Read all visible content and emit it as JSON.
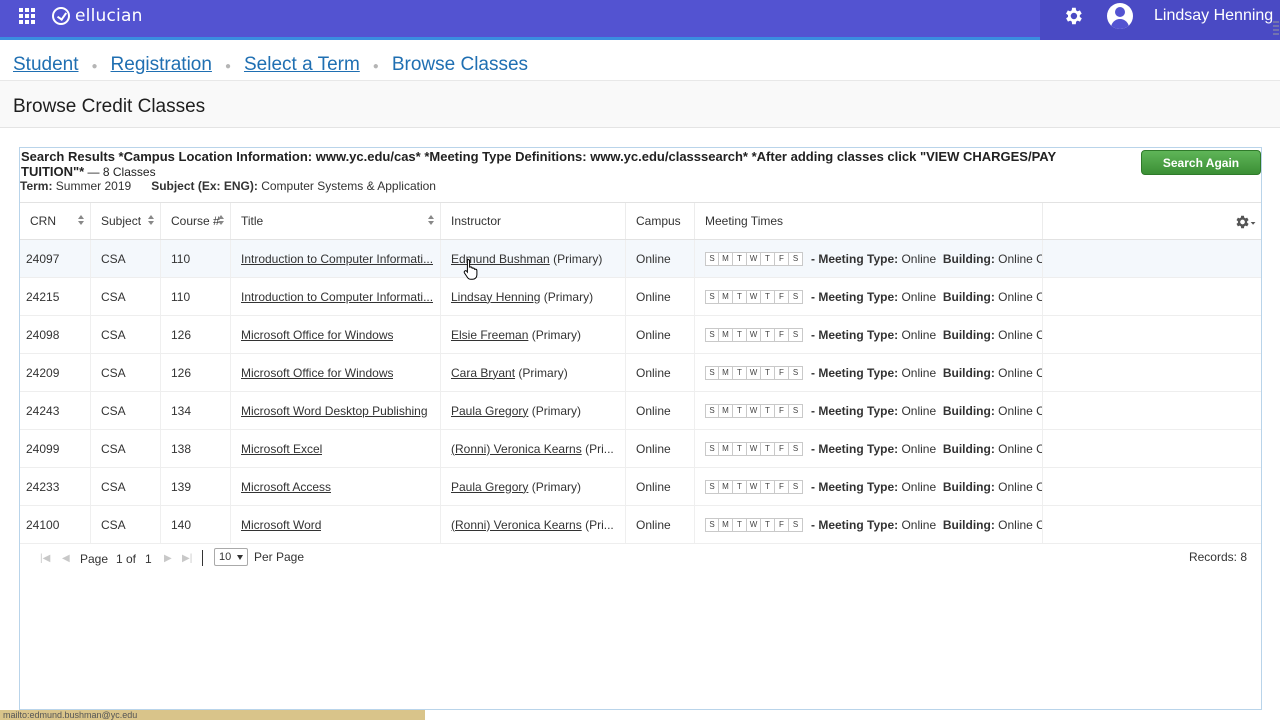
{
  "topbar": {
    "brand": "ellucian",
    "user_name": "Lindsay Henning",
    "icons": [
      "apps-grid-icon",
      "ellucian-logo-icon",
      "gear-icon",
      "user-avatar-icon"
    ],
    "colors": {
      "bar": "#5353d1",
      "accent": "#3a8de0"
    }
  },
  "breadcrumb": {
    "items": [
      "Student",
      "Registration",
      "Select a Term"
    ],
    "current": "Browse Classes",
    "separator": "●"
  },
  "page": {
    "title": "Browse Credit Classes"
  },
  "results": {
    "title": "Search Results *Campus Location Information: www.yc.edu/cas* *Meeting Type Definitions: www.yc.edu/classsearch* *After adding classes click \"VIEW CHARGES/PAY TUITION\"*",
    "count": " — 8 Classes",
    "term_label": "Term:",
    "term_value": "Summer 2019",
    "subject_label": "Subject (Ex: ENG):",
    "subject_value": "Computer Systems & Application",
    "search_again_label": "Search Again"
  },
  "table": {
    "columns": [
      "CRN",
      "Subject",
      "Course #",
      "Title",
      "Instructor",
      "Campus",
      "Meeting Times"
    ],
    "days": [
      "S",
      "M",
      "T",
      "W",
      "T",
      "F",
      "S"
    ],
    "meeting_type_label": "- Meeting Type:",
    "meeting_type_value": "Online",
    "building_label": "Building:",
    "building_value": "Online Cou",
    "rows": [
      {
        "crn": "24097",
        "subject": "CSA",
        "course": "110",
        "title": "Introduction to Computer Informati...",
        "instructor": "Edmund Bushman",
        "role": " (Primary)",
        "campus": "Online"
      },
      {
        "crn": "24215",
        "subject": "CSA",
        "course": "110",
        "title": "Introduction to Computer Informati...",
        "instructor": "Lindsay Henning",
        "role": " (Primary)",
        "campus": "Online"
      },
      {
        "crn": "24098",
        "subject": "CSA",
        "course": "126",
        "title": "Microsoft Office for Windows",
        "instructor": "Elsie Freeman",
        "role": " (Primary)",
        "campus": "Online"
      },
      {
        "crn": "24209",
        "subject": "CSA",
        "course": "126",
        "title": "Microsoft Office for Windows",
        "instructor": "Cara Bryant",
        "role": " (Primary)",
        "campus": "Online"
      },
      {
        "crn": "24243",
        "subject": "CSA",
        "course": "134",
        "title": "Microsoft Word Desktop Publishing",
        "instructor": "Paula Gregory",
        "role": " (Primary)",
        "campus": "Online"
      },
      {
        "crn": "24099",
        "subject": "CSA",
        "course": "138",
        "title": "Microsoft Excel",
        "instructor": "(Ronni) Veronica Kearns",
        "role": " (Pri...",
        "campus": "Online"
      },
      {
        "crn": "24233",
        "subject": "CSA",
        "course": "139",
        "title": "Microsoft Access",
        "instructor": "Paula Gregory",
        "role": " (Primary)",
        "campus": "Online"
      },
      {
        "crn": "24100",
        "subject": "CSA",
        "course": "140",
        "title": "Microsoft Word",
        "instructor": "(Ronni) Veronica Kearns",
        "role": " (Pri...",
        "campus": "Online"
      }
    ]
  },
  "pager": {
    "page_label": "Page",
    "page_value": "1 of",
    "total_pages": "1",
    "per_page_value": "10",
    "per_page_label": "Per Page",
    "records": "Records: 8"
  },
  "status_bar": {
    "text": "mailto:edmund.bushman@yc.edu"
  }
}
